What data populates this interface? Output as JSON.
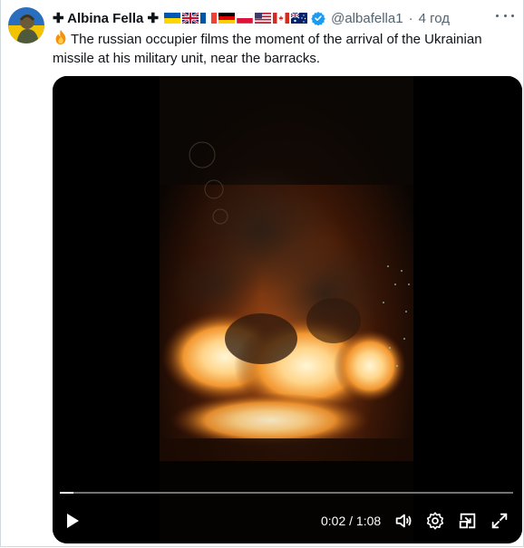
{
  "post": {
    "display_name": "✚ Albina Fella ✚",
    "flags": [
      "ua-flag",
      "uk-flag",
      "fr-flag",
      "de-flag",
      "pl-flag",
      "us-flag",
      "ca-flag",
      "au-flag"
    ],
    "handle": "@albafella1",
    "separator": "·",
    "time": "4 год",
    "text": "The russian occupier films the moment of the arrival of the Ukrainian missile at his military unit, near the barracks.",
    "leading_emoji": "fire-emoji"
  },
  "video": {
    "current_time": "0:02",
    "time_separator": "/",
    "duration": "1:08",
    "progress_fraction": 0.0294,
    "icons": [
      "play-icon",
      "volume-icon",
      "settings-icon",
      "pip-icon",
      "fullscreen-icon"
    ]
  },
  "colors": {
    "text_primary": "#0f1419",
    "text_secondary": "#536471",
    "verified_blue": "#1d9bf0"
  }
}
